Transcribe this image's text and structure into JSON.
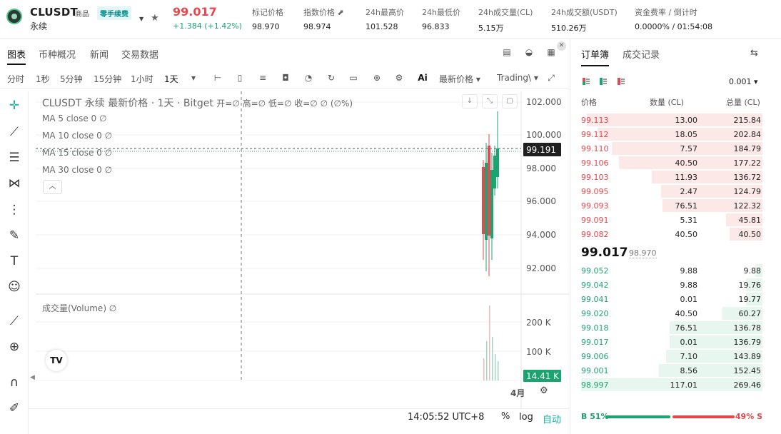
{
  "header": {
    "symbol": "CLUSDT",
    "tag_goods": "商品",
    "tag_fee": "零手续费",
    "subtitle": "永续",
    "price": "99.017",
    "change": "+1.384 (+1.42%)",
    "stats": [
      {
        "label": "标记价格",
        "value": "98.970"
      },
      {
        "label": "指数价格 ⬈",
        "value": "98.974"
      },
      {
        "label": "24h最高价",
        "value": "101.528"
      },
      {
        "label": "24h最低价",
        "value": "96.833"
      },
      {
        "label": "24h成交量(CL)",
        "value": "5.15万"
      },
      {
        "label": "24h成交额(USDT)",
        "value": "510.26万"
      },
      {
        "label": "资金费率 / 倒计时",
        "value": "0.0000%  / 01:54:08"
      }
    ]
  },
  "tabs": [
    "图表",
    "币种概况",
    "新闻",
    "交易数据"
  ],
  "timeframes": [
    "分时",
    "1秒",
    "5分钟",
    "15分钟",
    "1小时",
    "1天"
  ],
  "toolbar": {
    "latest_price": "最新价格 ▾",
    "trading_view": "Trading\\ ▾",
    "ai": "Ai"
  },
  "chart": {
    "title": "CLUSDT 永续 最新价格 · 1天 · Bitget",
    "ohlc": "开=∅  高=∅  低=∅  收=∅  ∅ (∅%)",
    "ma": [
      "MA 5 close 0  ∅",
      "MA 10 close 0  ∅",
      "MA 15 close 0  ∅",
      "MA 30 close 0  ∅"
    ],
    "volume_title": "成交量(Volume)  ∅",
    "price_ticks": [
      "102.000",
      "100.000",
      "98.000",
      "96.000",
      "94.000",
      "92.000"
    ],
    "current_price_label": "99.191",
    "volume_ticks": [
      "200 K",
      "100 K"
    ],
    "current_volume_label": "14.41 K",
    "time_label": "4月",
    "clock": "14:05:52 UTC+8",
    "percent": "%",
    "log": "log",
    "auto": "自动"
  },
  "chart_data": {
    "type": "table",
    "title": "CLUSDT 永续 最新价格 · 1天 · Bitget",
    "price_axis": [
      92,
      102
    ],
    "volume_axis_ticks": [
      "200 K",
      "100 K"
    ]
  },
  "orderbook": {
    "tabs": [
      "订单簿",
      "成交记录"
    ],
    "precision": "0.001 ▾",
    "headers": [
      "价格",
      "数量 (CL)",
      "总量 (CL)"
    ],
    "asks": [
      {
        "price": "99.113",
        "qty": "13.00",
        "total": "215.84",
        "depth": 0.97
      },
      {
        "price": "99.112",
        "qty": "18.05",
        "total": "202.84",
        "depth": 0.91
      },
      {
        "price": "99.110",
        "qty": "7.57",
        "total": "184.79",
        "depth": 0.83
      },
      {
        "price": "99.106",
        "qty": "40.50",
        "total": "177.22",
        "depth": 0.79
      },
      {
        "price": "99.103",
        "qty": "11.93",
        "total": "136.72",
        "depth": 0.61
      },
      {
        "price": "99.095",
        "qty": "2.47",
        "total": "124.79",
        "depth": 0.56
      },
      {
        "price": "99.093",
        "qty": "76.51",
        "total": "122.32",
        "depth": 0.55
      },
      {
        "price": "99.091",
        "qty": "5.31",
        "total": "45.81",
        "depth": 0.2
      },
      {
        "price": "99.082",
        "qty": "40.50",
        "total": "40.50",
        "depth": 0.18
      }
    ],
    "mid_price": "99.017",
    "mark_price": "98.970",
    "bids": [
      {
        "price": "99.052",
        "qty": "9.88",
        "total": "9.88",
        "depth": 0.04
      },
      {
        "price": "99.042",
        "qty": "9.88",
        "total": "19.76",
        "depth": 0.09
      },
      {
        "price": "99.041",
        "qty": "0.01",
        "total": "19.77",
        "depth": 0.09
      },
      {
        "price": "99.020",
        "qty": "40.50",
        "total": "60.27",
        "depth": 0.22
      },
      {
        "price": "99.018",
        "qty": "76.51",
        "total": "136.78",
        "depth": 0.51
      },
      {
        "price": "99.017",
        "qty": "0.01",
        "total": "136.79",
        "depth": 0.51
      },
      {
        "price": "99.006",
        "qty": "7.10",
        "total": "143.89",
        "depth": 0.53
      },
      {
        "price": "99.001",
        "qty": "8.56",
        "total": "152.45",
        "depth": 0.57
      },
      {
        "price": "98.997",
        "qty": "117.01",
        "total": "269.46",
        "depth": 1.0
      }
    ],
    "buy_ratio": "B 51%",
    "sell_ratio": "49% S"
  },
  "colors": {
    "up": "#1aa470",
    "down": "#e5484d",
    "accent": "#0fb3a3"
  }
}
